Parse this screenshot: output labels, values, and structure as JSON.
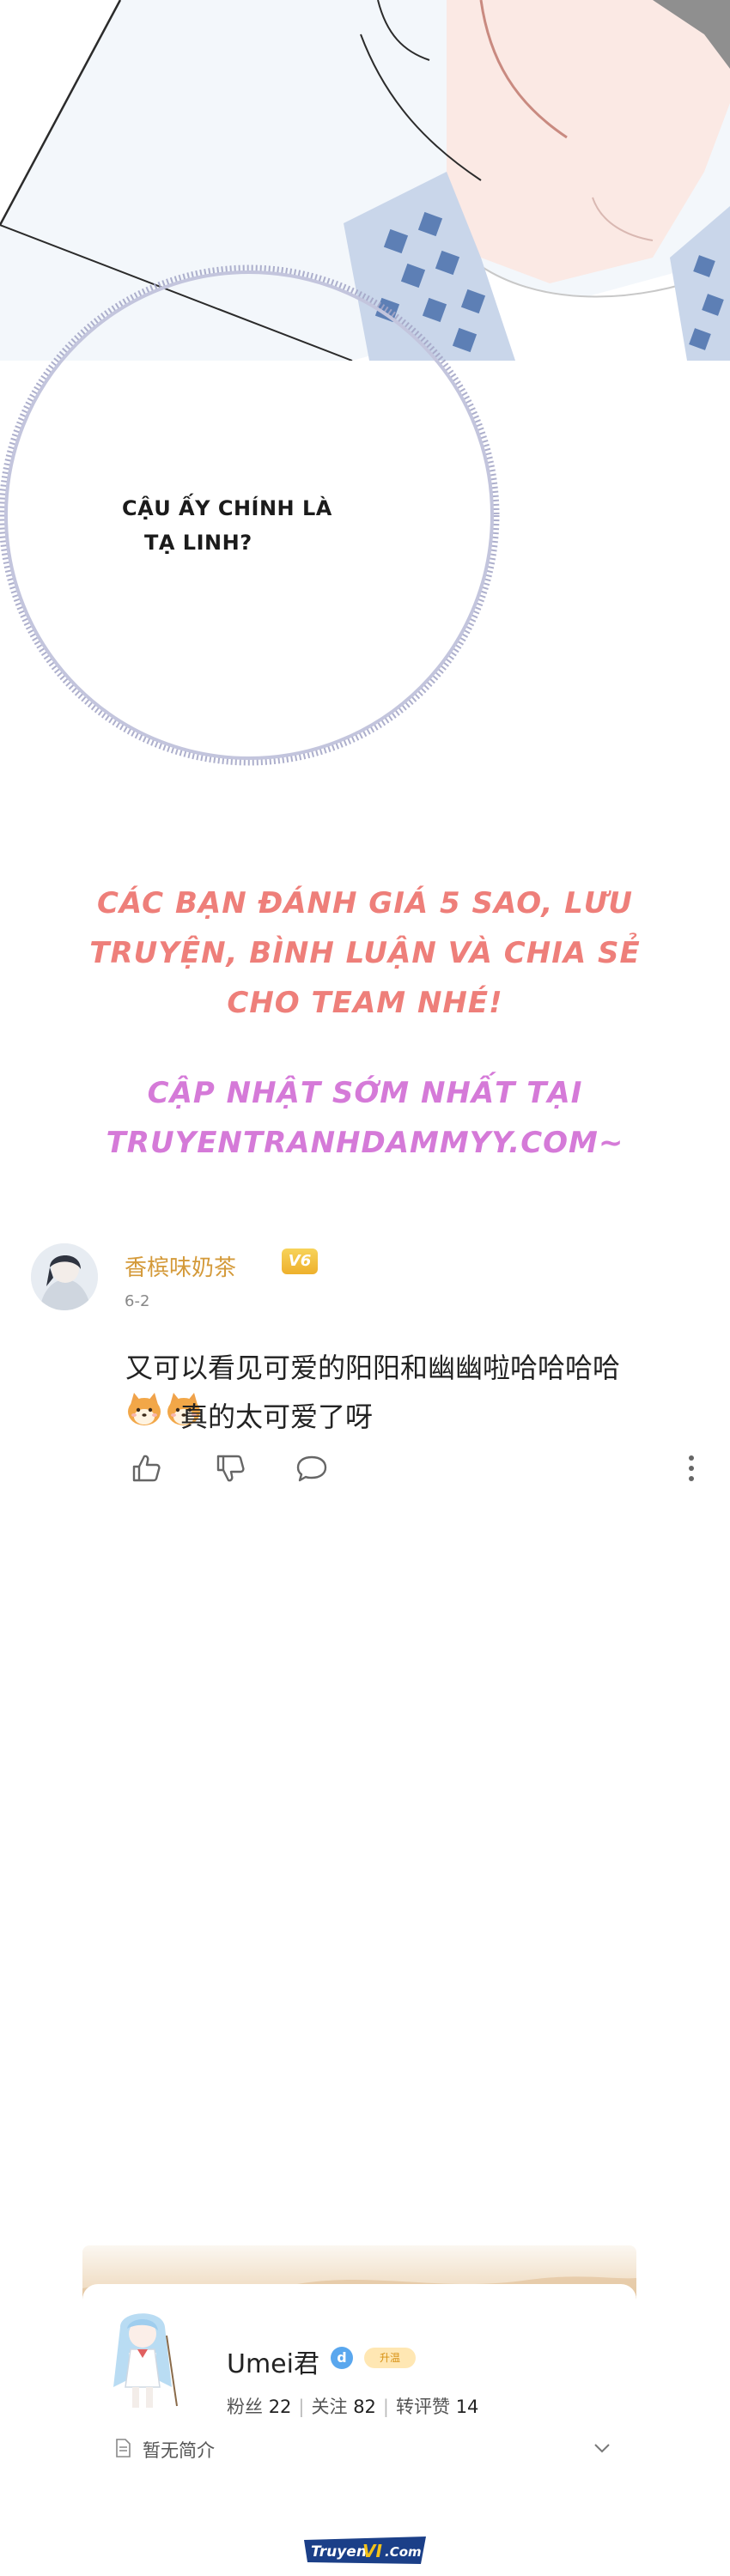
{
  "bubble": {
    "line1": "CẬU ẤY CHÍNH LÀ",
    "line2": "TẠ LINH?"
  },
  "promo": {
    "line1": "CÁC BẠN ĐÁNH GIÁ 5 SAO, LƯU",
    "line2": "TRUYỆN, BÌNH LUẬN VÀ CHIA SẺ",
    "line3": "CHO TEAM NHÉ!",
    "line4": "CẬP NHẬT SỚM NHẤT TẠI",
    "line5": "TRUYENTRANHDAMMYY.COM~"
  },
  "comment": {
    "username": "香槟味奶茶",
    "vip_level": "V6",
    "date": "6-2",
    "text_line1": "又可以看见可爱的阳阳和幽幽啦哈哈哈哈",
    "text_line2": "真的太可爱了呀",
    "icons": [
      "thumbs-up-icon",
      "thumbs-down-icon",
      "reply-bubble-icon",
      "more-vertical-icon"
    ]
  },
  "profile": {
    "username": "Umei君",
    "badge": "升温",
    "fans_label": "粉丝",
    "fans": "22",
    "follow_label": "关注",
    "follow": "82",
    "likes_label": "转评赞",
    "likes": "14",
    "bio": "暂无简介"
  },
  "watermark": {
    "text_part1": "Truyen",
    "text_part2": "VI",
    "text_part3": ".Com"
  },
  "colors": {
    "promo_red": "#ee7f7a",
    "promo_pink": "#d57ad8",
    "username_gold": "#d49a3a",
    "bubble_ring": "#a4a6c6"
  }
}
